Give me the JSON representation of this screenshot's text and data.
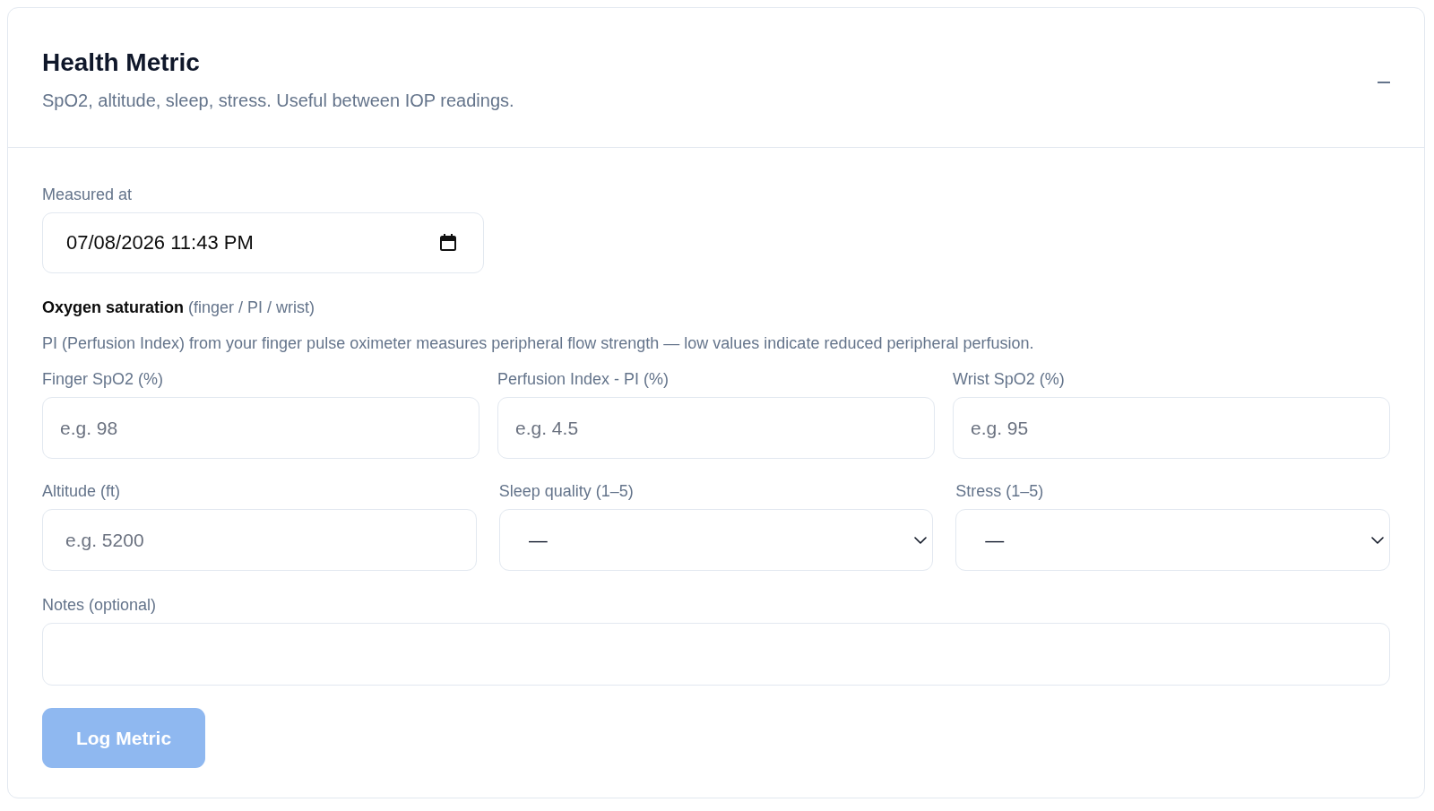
{
  "panel": {
    "title": "Health Metric",
    "subtitle": "SpO2, altitude, sleep, stress. Useful between IOP readings.",
    "expanded": true
  },
  "measured_at": {
    "label": "Measured at",
    "value": "07/08/2026 11:43 PM"
  },
  "oxygen": {
    "heading": "**Oxygen saturation** (finger / PI / wrist)",
    "description": "PI (Perfusion Index) from your finger pulse oximeter measures peripheral flow strength — low values indicate reduced peripheral perfusion."
  },
  "field_rows": [
    [
      {
        "kind": "input",
        "label": "Finger SpO2 (%)",
        "placeholder": "e.g. 98"
      },
      {
        "kind": "input",
        "label": "Perfusion Index - PI (%)",
        "placeholder": "e.g. 4.5"
      },
      {
        "kind": "input",
        "label": "Wrist SpO2 (%)",
        "placeholder": "e.g. 95"
      }
    ],
    [
      {
        "kind": "input",
        "label": "Altitude (ft)",
        "placeholder": "e.g. 5200"
      },
      {
        "kind": "select",
        "label": "Sleep quality (1–5)",
        "value": "—"
      },
      {
        "kind": "select",
        "label": "Stress (1–5)",
        "value": "—"
      }
    ]
  ],
  "notes": {
    "label": "Notes (optional)"
  },
  "submit_button": {
    "label": "Log Metric",
    "disabled": true
  }
}
